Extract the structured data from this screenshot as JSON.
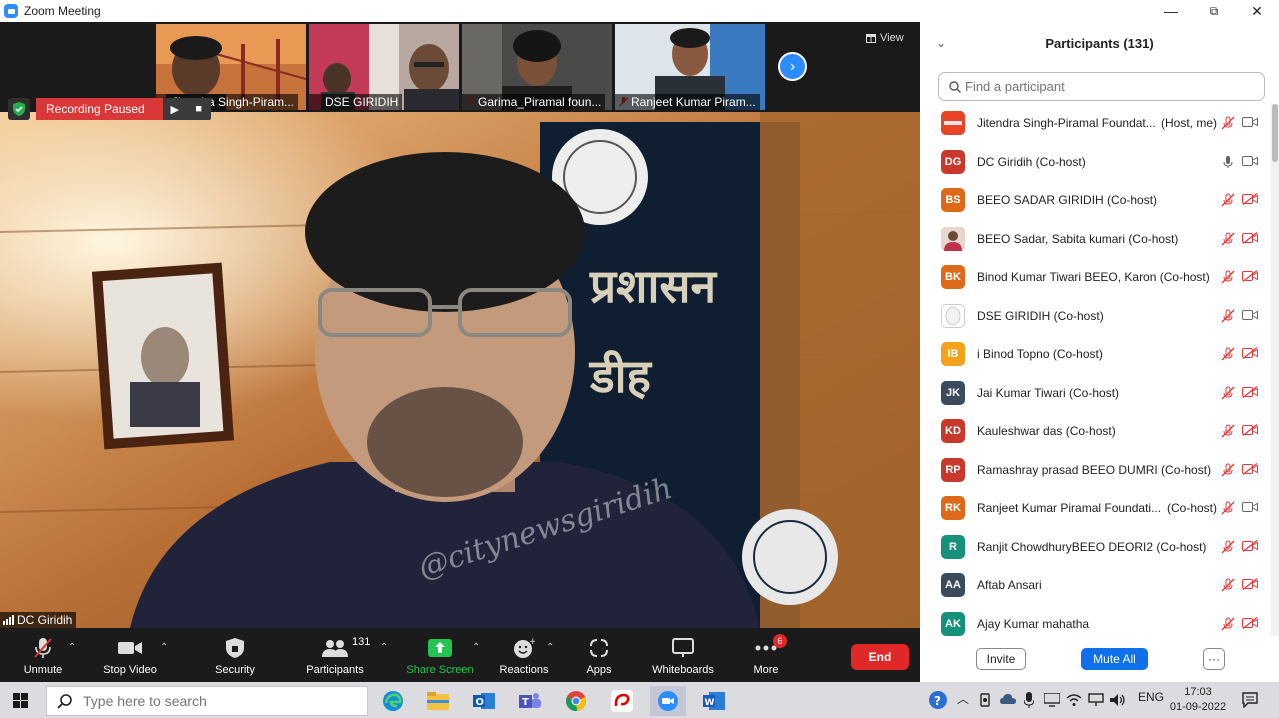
{
  "window": {
    "title": "Zoom Meeting",
    "minimize": "—",
    "maximize": "⧉",
    "close": "✕"
  },
  "thumbnails": [
    {
      "name": "Jitendra Singh-Piram..."
    },
    {
      "name": "DSE GIRIDIH"
    },
    {
      "name": "Garima_Piramal foun..."
    },
    {
      "name": "Ranjeet Kumar Piram..."
    }
  ],
  "view_label": "View",
  "recording": {
    "label": "Recording Paused",
    "play": "▶",
    "stop": "■"
  },
  "speaker_name": "DC Giridih",
  "watermark": "@citynewsgiridih",
  "toolbar": {
    "unmute": "Unmute",
    "stop_video": "Stop Video",
    "security": "Security",
    "participants": "Participants",
    "participants_count": "131",
    "share_screen": "Share Screen",
    "reactions": "Reactions",
    "apps": "Apps",
    "whiteboards": "Whiteboards",
    "more": "More",
    "more_badge": "6",
    "end": "End"
  },
  "panel": {
    "title": "Participants (131)",
    "search_placeholder": "Find a participant",
    "invite": "Invite",
    "mute_all": "Mute All",
    "more": "···"
  },
  "participants": [
    {
      "initials": "",
      "avatar": "logo",
      "color": "#e8442a",
      "name": "Jitendra Singh-Piramal Foundat...",
      "suffix": "(Host, me)",
      "mic": "muted",
      "video": "on"
    },
    {
      "initials": "DG",
      "avatar": "initials",
      "color": "#c8382c",
      "name": "DC Giridih (Co-host)",
      "suffix": "",
      "mic": "on",
      "video": "on"
    },
    {
      "initials": "BS",
      "avatar": "initials",
      "color": "#de6a19",
      "name": "BEEO SADAR GIRIDIH (Co-host)",
      "suffix": "",
      "mic": "muted",
      "video": "off"
    },
    {
      "initials": "",
      "avatar": "photo",
      "color": "#7a5a4a",
      "name": "BEEO Sadar, Sabita kumari (Co-host)",
      "suffix": "",
      "mic": "muted",
      "video": "off"
    },
    {
      "initials": "BK",
      "avatar": "initials",
      "color": "#de6a19",
      "name": "Binod Kumar Tiwari BEEO, Karon (Co-host)",
      "suffix": "",
      "mic": "muted",
      "video": "off"
    },
    {
      "initials": "",
      "avatar": "blank",
      "color": "#e8e8e8",
      "name": "DSE GIRIDIH (Co-host)",
      "suffix": "",
      "mic": "muted",
      "video": "on"
    },
    {
      "initials": "IB",
      "avatar": "initials",
      "color": "#f2a31b",
      "name": "i Binod Topno (Co-host)",
      "suffix": "",
      "mic": "muted",
      "video": "off"
    },
    {
      "initials": "JK",
      "avatar": "initials",
      "color": "#3b4a5c",
      "name": "Jai Kumar Tiwari (Co-host)",
      "suffix": "",
      "mic": "muted",
      "video": "off"
    },
    {
      "initials": "KD",
      "avatar": "initials",
      "color": "#c8382c",
      "name": "Kauleshwar das (Co-host)",
      "suffix": "",
      "mic": "muted",
      "video": "off"
    },
    {
      "initials": "RP",
      "avatar": "initials",
      "color": "#c8382c",
      "name": "Ramashray prasad BEEO DUMRI (Co-host)",
      "suffix": "",
      "mic": "muted",
      "video": "off"
    },
    {
      "initials": "RK",
      "avatar": "initials",
      "color": "#de6a19",
      "name": "Ranjeet Kumar Piramal Foundati...",
      "suffix": "(Co-host)",
      "mic": "muted",
      "video": "on"
    },
    {
      "initials": "R",
      "avatar": "initials",
      "color": "#17917a",
      "name": "Ranjit ChowdhuryBEEO DEORI2 (Co-host)",
      "suffix": "",
      "mic": "muted",
      "video": "off"
    },
    {
      "initials": "AA",
      "avatar": "initials",
      "color": "#3b4a5c",
      "name": "Aftab Ansari",
      "suffix": "",
      "mic": "muted",
      "video": "off"
    },
    {
      "initials": "AK",
      "avatar": "initials",
      "color": "#17917a",
      "name": "Ajay Kumar mahatha",
      "suffix": "",
      "mic": "muted",
      "video": "off"
    }
  ],
  "taskbar": {
    "search_placeholder": "Type here to search",
    "lang": "ENG",
    "time": "17:03",
    "date": "01-09-2022"
  }
}
